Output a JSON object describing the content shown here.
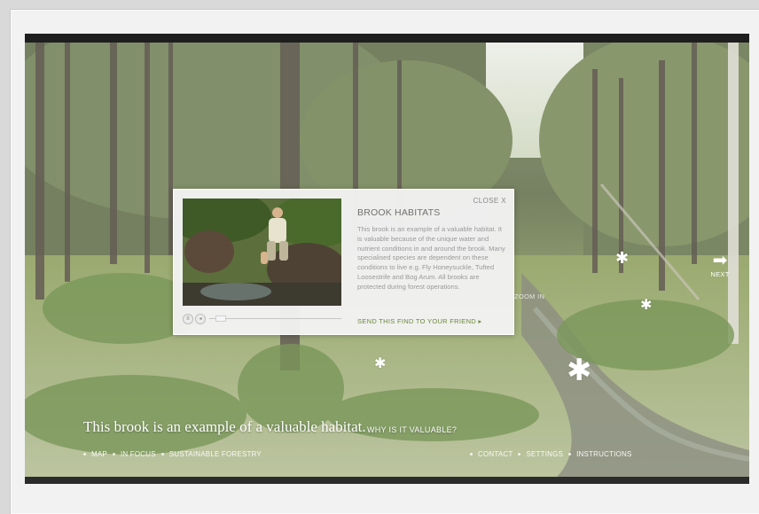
{
  "modal": {
    "close_label": "CLOSE X",
    "title": "BROOK HABITATS",
    "body": "This brook is an example of a valuable habitat. It is valuable because of the unique water and nutrient conditions in and around the brook. Many specialised species are dependent on these conditions to live e.g. Fly Honeysuckle, Tufted Loosestrife and Bog Arum. All brooks are protected during forest operations.",
    "share_label": "SEND THIS FIND TO YOUR FRIEND ▸",
    "video": {
      "progress": 0.05
    }
  },
  "scene": {
    "next_label": "NEXT",
    "zoom_label": "ZOOM IN",
    "hotspot_icon": "asterisk-icon"
  },
  "caption": {
    "text": "This brook is an example of a valuable habitat.",
    "link": "WHY IS IT VALUABLE?"
  },
  "nav_left": [
    "MAP",
    "IN FOCUS",
    "SUSTAINABLE FORESTRY"
  ],
  "nav_right": [
    "CONTACT",
    "SETTINGS",
    "INSTRUCTIONS"
  ],
  "colors": {
    "accent_green": "#6a8a3a",
    "overlay_white": "#ffffff"
  }
}
